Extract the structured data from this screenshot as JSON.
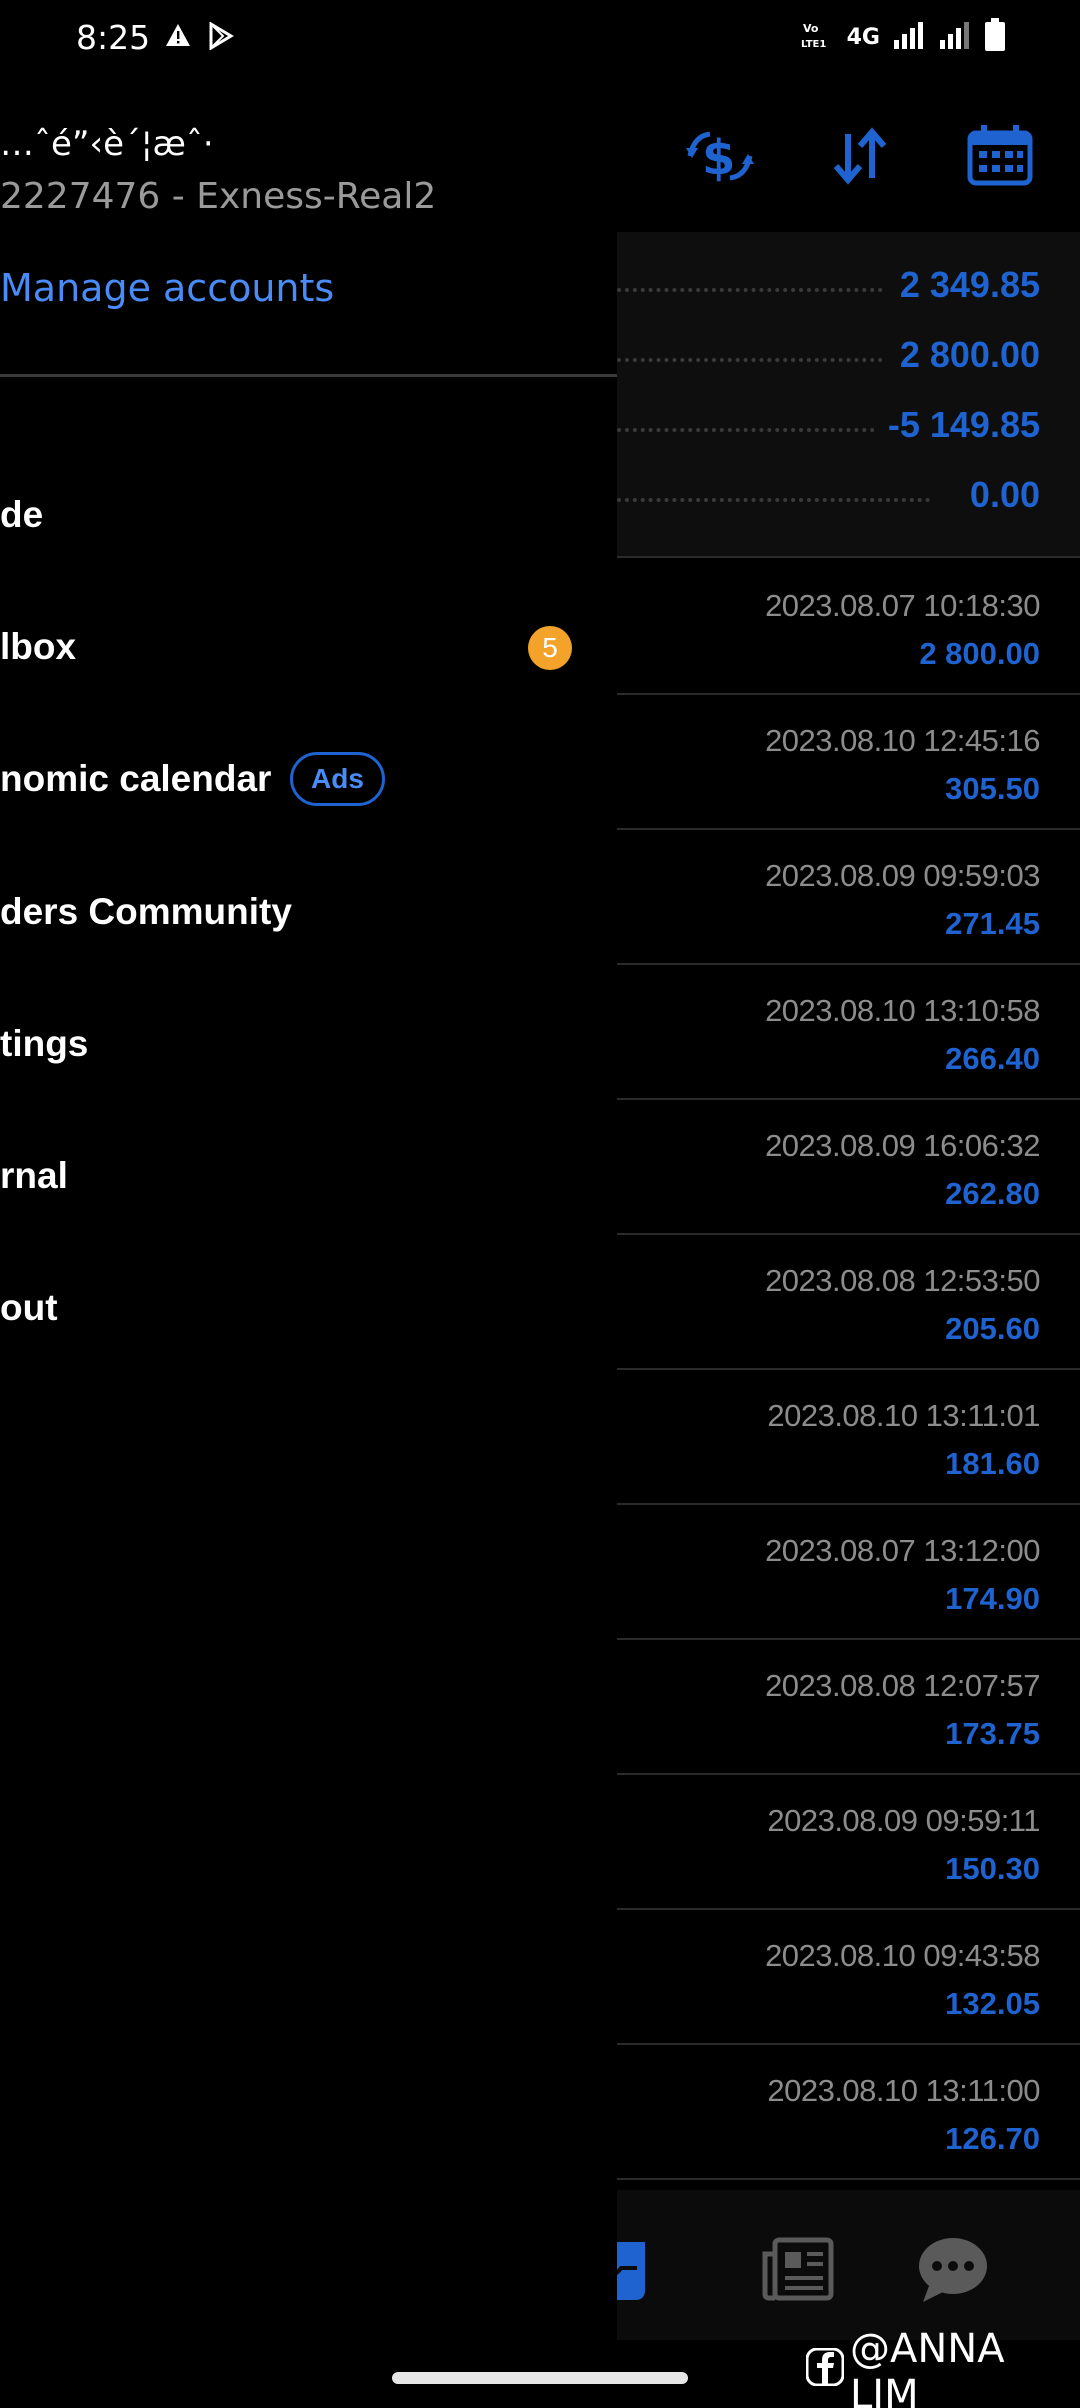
{
  "status_bar": {
    "time": "8:25",
    "network": "4G",
    "icons": [
      "warning-icon",
      "play-store-icon",
      "volte-icon",
      "signal-icon",
      "signal-icon",
      "battery-icon"
    ]
  },
  "drawer": {
    "account_name": "…ˆé”‹è´¦æˆ·",
    "account_id": "2227476 - Exness-Real2",
    "manage_label": "Manage accounts",
    "menu": [
      {
        "label": "de"
      },
      {
        "label": "lbox",
        "badge": "5"
      },
      {
        "label": "nomic calendar",
        "tag": "Ads"
      },
      {
        "label": "ders Community"
      },
      {
        "label": "tings"
      },
      {
        "label": "rnal"
      },
      {
        "label": "out"
      }
    ]
  },
  "toolbar": {
    "icons": [
      "currency-exchange-icon",
      "sort-icon",
      "calendar-icon"
    ]
  },
  "summary": {
    "rows": [
      {
        "value": "2 349.85"
      },
      {
        "value": "2 800.00"
      },
      {
        "value": "-5 149.85"
      },
      {
        "value": "0.00"
      }
    ]
  },
  "deals": [
    {
      "datetime": "2023.08.07 10:18:30",
      "amount": "2 800.00"
    },
    {
      "datetime": "2023.08.10 12:45:16",
      "amount": "305.50"
    },
    {
      "datetime": "2023.08.09 09:59:03",
      "amount": "271.45"
    },
    {
      "datetime": "2023.08.10 13:10:58",
      "amount": "266.40"
    },
    {
      "datetime": "2023.08.09 16:06:32",
      "amount": "262.80"
    },
    {
      "datetime": "2023.08.08 12:53:50",
      "amount": "205.60"
    },
    {
      "datetime": "2023.08.10 13:11:01",
      "amount": "181.60"
    },
    {
      "datetime": "2023.08.07 13:12:00",
      "amount": "174.90"
    },
    {
      "datetime": "2023.08.08 12:07:57",
      "amount": "173.75"
    },
    {
      "datetime": "2023.08.09 09:59:11",
      "amount": "150.30"
    },
    {
      "datetime": "2023.08.10 09:43:58",
      "amount": "132.05"
    },
    {
      "datetime": "2023.08.10 13:11:00",
      "amount": "126.70"
    }
  ],
  "bottom_nav": {
    "icons": [
      "history-icon",
      "news-icon",
      "chat-icon"
    ]
  },
  "watermark": "@ANNA LIM",
  "colors": {
    "accent": "#1f63d1",
    "link": "#4a8cf7",
    "badge": "#f3a32a"
  }
}
